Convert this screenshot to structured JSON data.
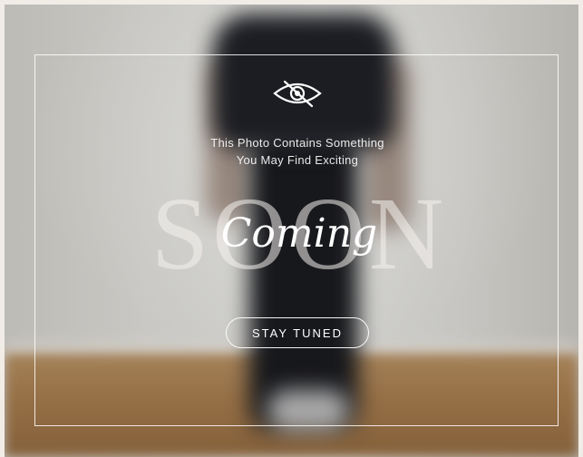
{
  "overlay": {
    "headline_line1": "This Photo Contains Something",
    "headline_line2": "You May Find Exciting",
    "big_word": "SOON",
    "script_word": "Coming",
    "button_label": "STAY TUNED",
    "icon": "eye-slash-icon"
  },
  "colors": {
    "text": "#ffffff",
    "page_background": "#f1ece6",
    "floor": "#956f45",
    "clothing": "#1b1d22"
  }
}
